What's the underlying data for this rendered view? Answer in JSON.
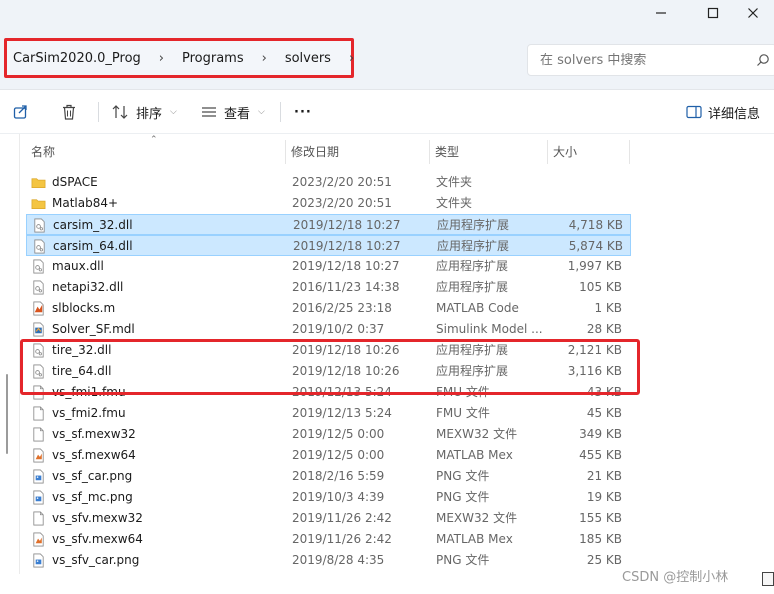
{
  "breadcrumb": [
    "CarSim2020.0_Prog",
    "Programs",
    "solvers"
  ],
  "search": {
    "placeholder": "在 solvers 中搜索"
  },
  "toolbar": {
    "sort_label": "排序",
    "view_label": "查看",
    "details_label": "详细信息",
    "more_label": "···"
  },
  "columns": {
    "name": "名称",
    "date": "修改日期",
    "type": "类型",
    "size": "大小"
  },
  "files": [
    {
      "name": "dSPACE",
      "date": "2023/2/20 20:51",
      "type": "文件夹",
      "size": "",
      "icon": "folder-icon",
      "selected": false
    },
    {
      "name": "Matlab84+",
      "date": "2023/2/20 20:51",
      "type": "文件夹",
      "size": "",
      "icon": "folder-icon",
      "selected": false
    },
    {
      "name": "carsim_32.dll",
      "date": "2019/12/18 10:27",
      "type": "应用程序扩展",
      "size": "4,718 KB",
      "icon": "dll-icon",
      "selected": true
    },
    {
      "name": "carsim_64.dll",
      "date": "2019/12/18 10:27",
      "type": "应用程序扩展",
      "size": "5,874 KB",
      "icon": "dll-icon",
      "selected": true
    },
    {
      "name": "maux.dll",
      "date": "2019/12/18 10:27",
      "type": "应用程序扩展",
      "size": "1,997 KB",
      "icon": "dll-icon",
      "selected": false
    },
    {
      "name": "netapi32.dll",
      "date": "2016/11/23 14:38",
      "type": "应用程序扩展",
      "size": "105 KB",
      "icon": "dll-icon",
      "selected": false
    },
    {
      "name": "slblocks.m",
      "date": "2016/2/25 23:18",
      "type": "MATLAB Code",
      "size": "1 KB",
      "icon": "matlab-code-icon",
      "selected": false
    },
    {
      "name": "Solver_SF.mdl",
      "date": "2019/10/2 0:37",
      "type": "Simulink Model ...",
      "size": "28 KB",
      "icon": "simulink-icon",
      "selected": false
    },
    {
      "name": "tire_32.dll",
      "date": "2019/12/18 10:26",
      "type": "应用程序扩展",
      "size": "2,121 KB",
      "icon": "dll-icon",
      "selected": false
    },
    {
      "name": "tire_64.dll",
      "date": "2019/12/18 10:26",
      "type": "应用程序扩展",
      "size": "3,116 KB",
      "icon": "dll-icon",
      "selected": false
    },
    {
      "name": "vs_fmi1.fmu",
      "date": "2019/12/13 5:24",
      "type": "FMU 文件",
      "size": "43 KB",
      "icon": "blank-file-icon",
      "selected": false
    },
    {
      "name": "vs_fmi2.fmu",
      "date": "2019/12/13 5:24",
      "type": "FMU 文件",
      "size": "45 KB",
      "icon": "blank-file-icon",
      "selected": false
    },
    {
      "name": "vs_sf.mexw32",
      "date": "2019/12/5 0:00",
      "type": "MEXW32 文件",
      "size": "349 KB",
      "icon": "blank-file-icon",
      "selected": false
    },
    {
      "name": "vs_sf.mexw64",
      "date": "2019/12/5 0:00",
      "type": "MATLAB Mex",
      "size": "455 KB",
      "icon": "matlab-mex-icon",
      "selected": false
    },
    {
      "name": "vs_sf_car.png",
      "date": "2018/2/16 5:59",
      "type": "PNG 文件",
      "size": "21 KB",
      "icon": "png-icon",
      "selected": false
    },
    {
      "name": "vs_sf_mc.png",
      "date": "2019/10/3 4:39",
      "type": "PNG 文件",
      "size": "19 KB",
      "icon": "png-icon",
      "selected": false
    },
    {
      "name": "vs_sfv.mexw32",
      "date": "2019/11/26 2:42",
      "type": "MEXW32 文件",
      "size": "155 KB",
      "icon": "blank-file-icon",
      "selected": false
    },
    {
      "name": "vs_sfv.mexw64",
      "date": "2019/11/26 2:42",
      "type": "MATLAB Mex",
      "size": "185 KB",
      "icon": "matlab-mex-icon",
      "selected": false
    },
    {
      "name": "vs_sfv_car.png",
      "date": "2019/8/28 4:35",
      "type": "PNG 文件",
      "size": "25 KB",
      "icon": "png-icon",
      "selected": false
    }
  ],
  "watermark": "CSDN @控制小林",
  "colors": {
    "highlight_red": "#e4262b",
    "selection_fill": "#cce8ff",
    "selection_border": "#99d1ff",
    "folder_yellow": "#f4c542"
  }
}
